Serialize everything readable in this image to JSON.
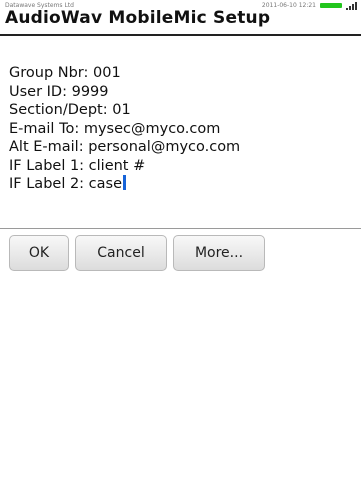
{
  "status_bar": {
    "carrier": "Datawave Systems Ltd",
    "datetime": "2011-06-10 12:21",
    "battery_color": "#22c51d"
  },
  "screen": {
    "title": "AudioWav MobileMic Setup"
  },
  "fields": [
    {
      "text": "Group Nbr: 001"
    },
    {
      "text": "User ID: 9999"
    },
    {
      "text": "Section/Dept: 01"
    },
    {
      "text": "E-mail To: mysec@myco.com"
    },
    {
      "text": "Alt E-mail: personal@myco.com"
    },
    {
      "text": "IF Label 1: client #"
    },
    {
      "text": "IF Label 2: case"
    }
  ],
  "buttons": {
    "ok": "OK",
    "cancel": "Cancel",
    "more": "More..."
  },
  "colors": {
    "caret": "#1663d8"
  }
}
